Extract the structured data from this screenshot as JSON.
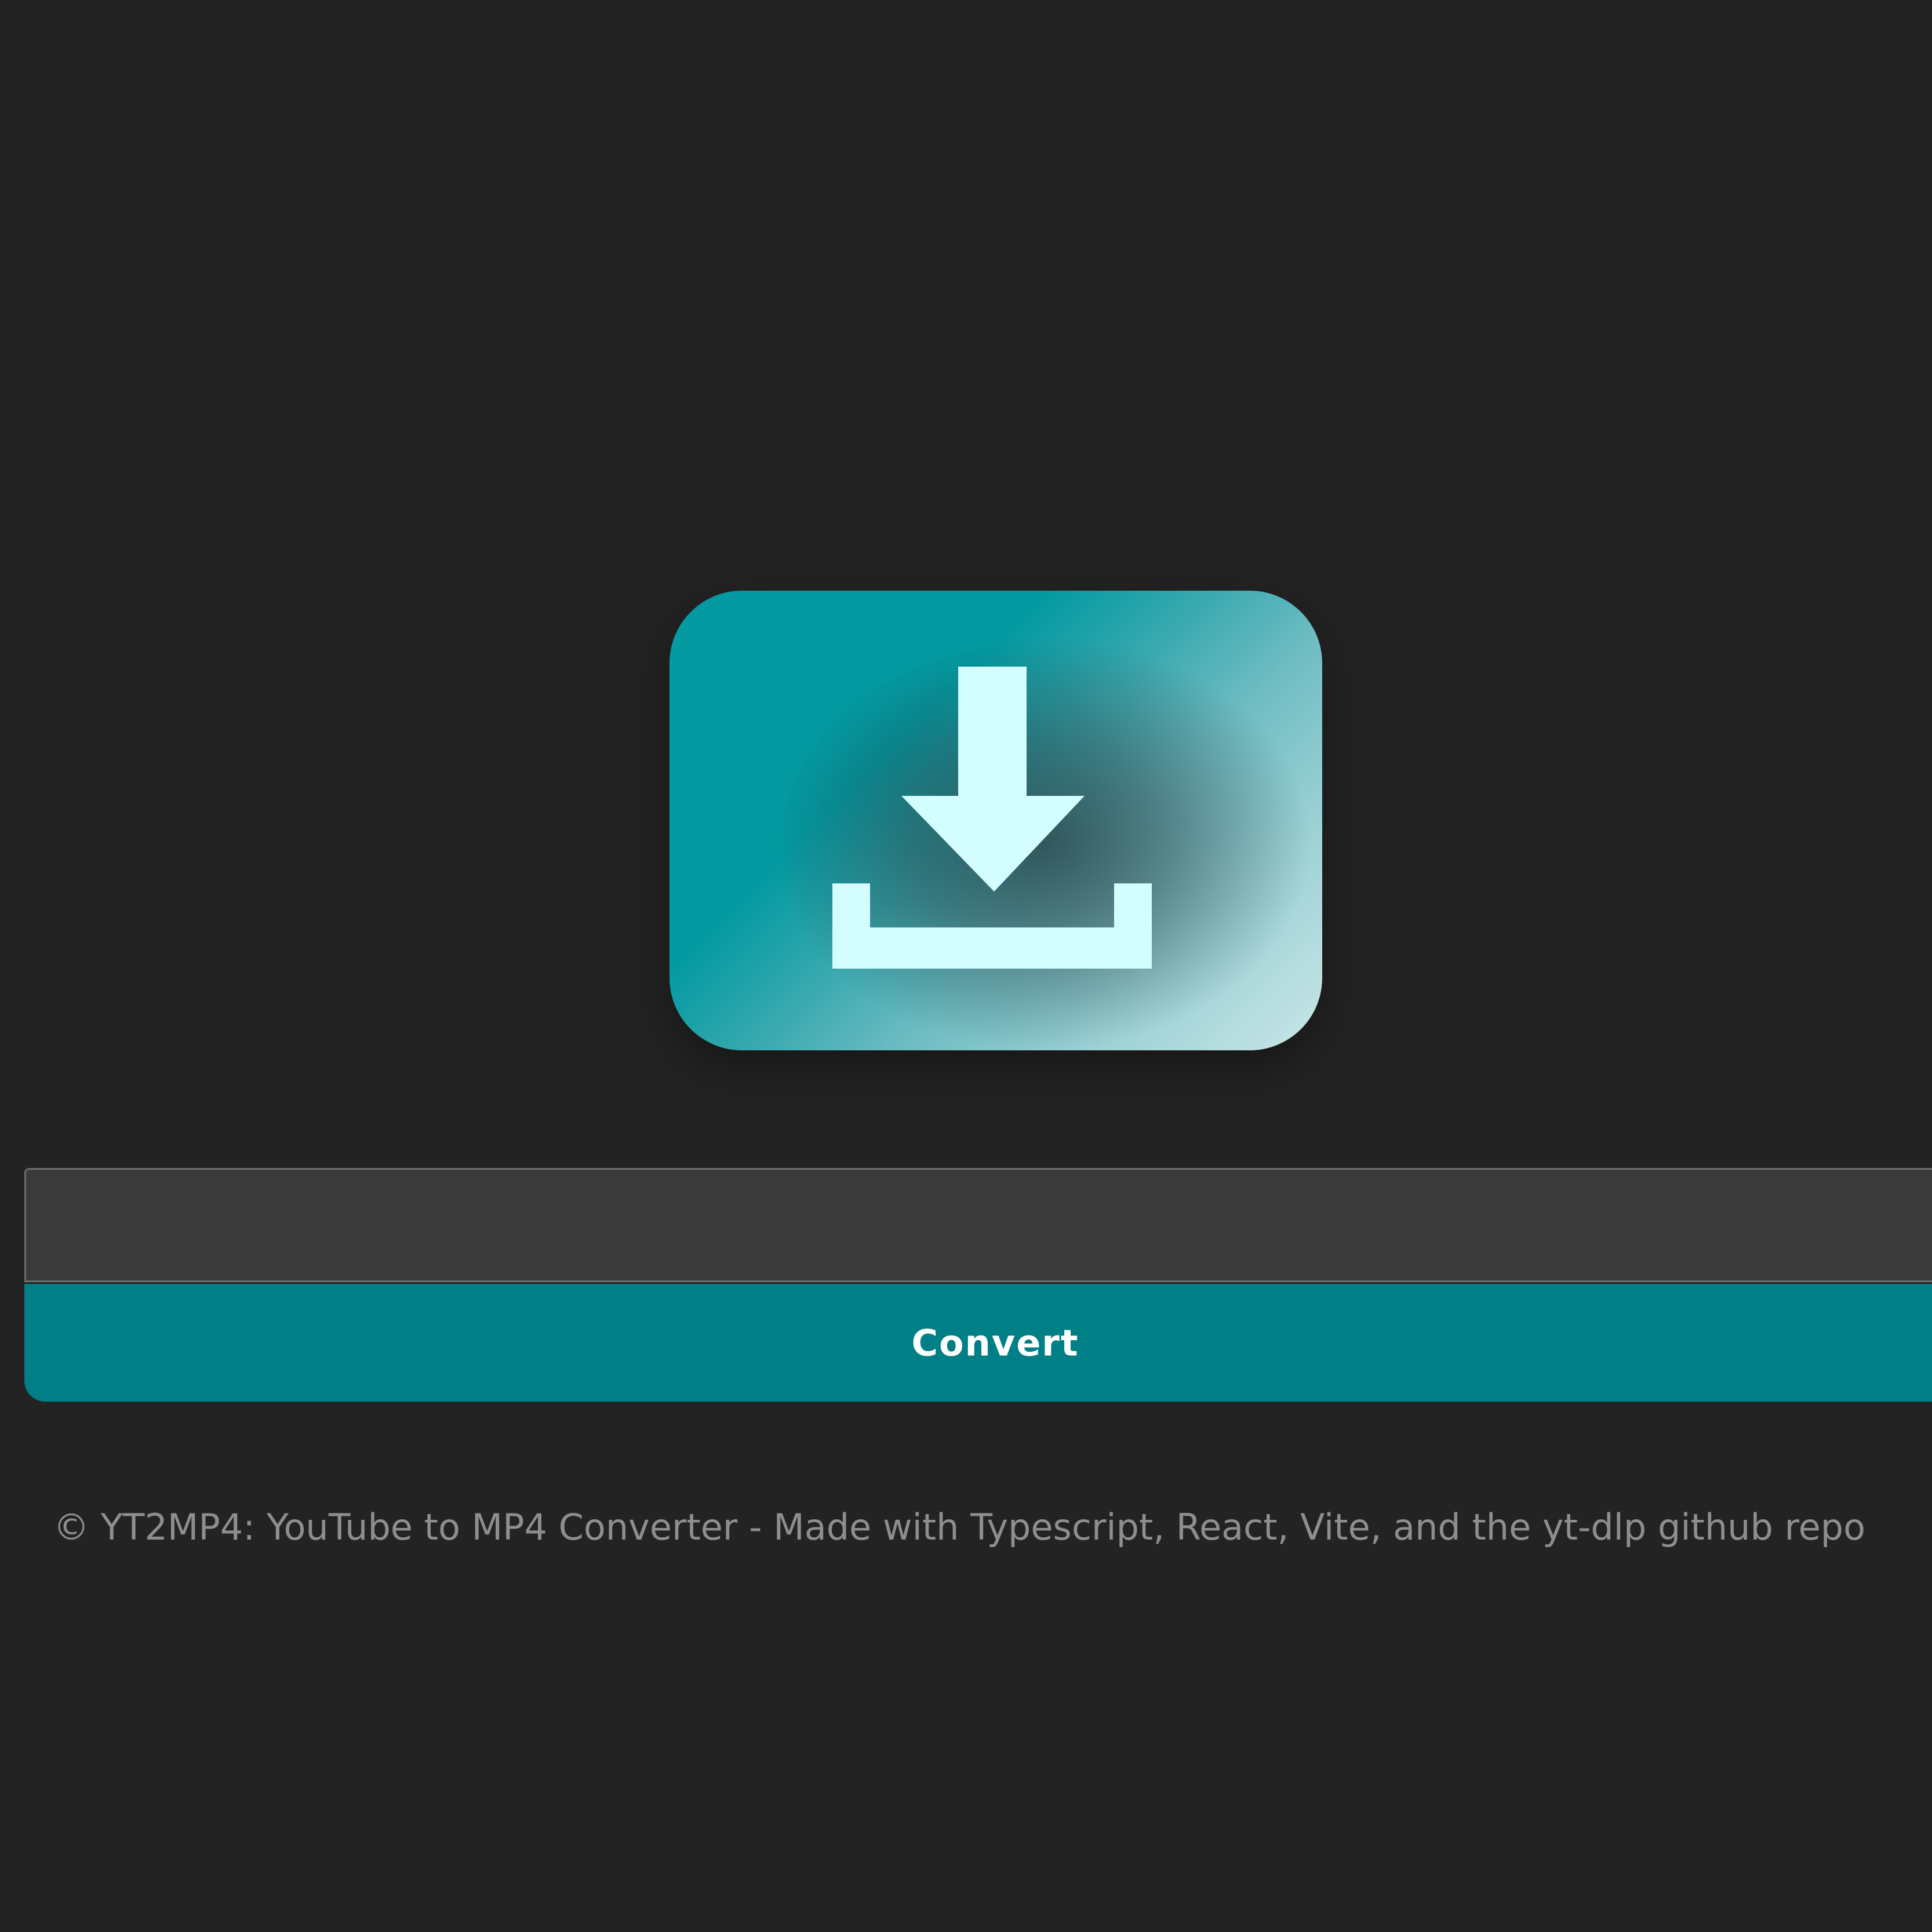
{
  "app": {
    "logo_icon": "download-tray-icon",
    "colors": {
      "background": "#232323",
      "accent": "#008086",
      "logo_teal": "#039aa2",
      "logo_arrow": "#d4fdff",
      "input_background": "#3a3a3a",
      "footer_text": "#8e8e8e"
    }
  },
  "form": {
    "url_value": "",
    "url_placeholder": "",
    "convert_label": "Convert"
  },
  "footer": {
    "text": "© YT2MP4: YouTube to MP4 Converter - Made with Typescript, React, Vite, and the yt-dlp github repo"
  }
}
